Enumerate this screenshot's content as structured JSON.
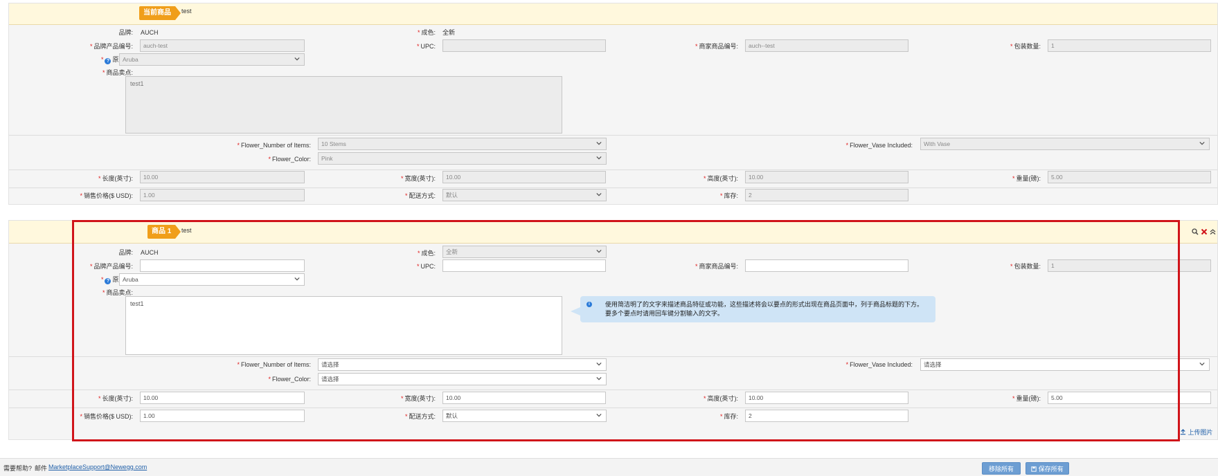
{
  "current_product": {
    "tag": "当前商品",
    "name": "test",
    "brand_label": "品牌:",
    "brand_value": "AUCH",
    "condition_label": "成色:",
    "condition_value": "全新",
    "brand_pn_label": "品牌产品编号:",
    "brand_pn_value": "auch-test",
    "upc_label": "UPC:",
    "upc_value": "",
    "seller_pn_label": "商家商品编号:",
    "seller_pn_value": "auch--test",
    "pkg_qty_label": "包装数量:",
    "pkg_qty_value": "1",
    "origin_label": "原产地:",
    "origin_value": "Aruba",
    "selling_points_label": "商品卖点:",
    "selling_points_value": "test1",
    "flower_items_label": "Flower_Number of Items:",
    "flower_items_value": "10 Stems",
    "flower_vase_label": "Flower_Vase Included:",
    "flower_vase_value": "With Vase",
    "flower_color_label": "Flower_Color:",
    "flower_color_value": "Pink",
    "length_label": "长度(英寸):",
    "length_value": "10.00",
    "width_label": "宽度(英寸):",
    "width_value": "10.00",
    "height_label": "高度(英寸):",
    "height_value": "10.00",
    "weight_label": "重量(磅):",
    "weight_value": "5.00",
    "price_label": "销售价格($ USD):",
    "price_value": "1.00",
    "shipping_label": "配送方式:",
    "shipping_value": "默认",
    "stock_label": "库存:",
    "stock_value": "2"
  },
  "item1": {
    "tag": "商品 1",
    "name": "test",
    "brand_label": "品牌:",
    "brand_value": "AUCH",
    "condition_label": "成色:",
    "condition_value": "全新",
    "brand_pn_label": "品牌产品编号:",
    "brand_pn_value": "",
    "upc_label": "UPC:",
    "upc_value": "",
    "seller_pn_label": "商家商品编号:",
    "seller_pn_value": "",
    "pkg_qty_label": "包装数量:",
    "pkg_qty_value": "1",
    "origin_label": "原产地:",
    "origin_value": "Aruba",
    "selling_points_label": "商品卖点:",
    "selling_points_value": "test1",
    "tooltip": "使用简洁明了的文字来描述商品特征或功能，这些描述将会以要点的形式出现在商品页面中，列于商品标题的下方。要多个要点时请用回车键分割输入的文字。",
    "flower_items_label": "Flower_Number of Items:",
    "flower_items_value": "请选择",
    "flower_vase_label": "Flower_Vase Included:",
    "flower_vase_value": "请选择",
    "flower_color_label": "Flower_Color:",
    "flower_color_value": "请选择",
    "length_label": "长度(英寸):",
    "length_value": "10.00",
    "width_label": "宽度(英寸):",
    "width_value": "10.00",
    "height_label": "高度(英寸):",
    "height_value": "10.00",
    "weight_label": "重量(磅):",
    "weight_value": "5.00",
    "price_label": "销售价格($ USD):",
    "price_value": "1.00",
    "shipping_label": "配送方式:",
    "shipping_value": "默认",
    "stock_label": "库存:",
    "stock_value": "2",
    "upload_label": "上传图片",
    "icons": [
      "search-icon",
      "remove-icon",
      "collapse-icon"
    ]
  },
  "footer": {
    "help_text": "需要帮助?",
    "email_label": "邮件",
    "email_link": "MarketplaceSupport@Newegg.com",
    "remove_all": "移除所有",
    "save_all": "保存所有"
  },
  "colors": {
    "header_bg": "#fff8dd",
    "tag_orange": "#f09e1a",
    "required_red": "#e02020",
    "highlight_red": "#d0141a",
    "button_blue": "#6d9ed3",
    "tooltip_blue": "#cfe4f6"
  }
}
